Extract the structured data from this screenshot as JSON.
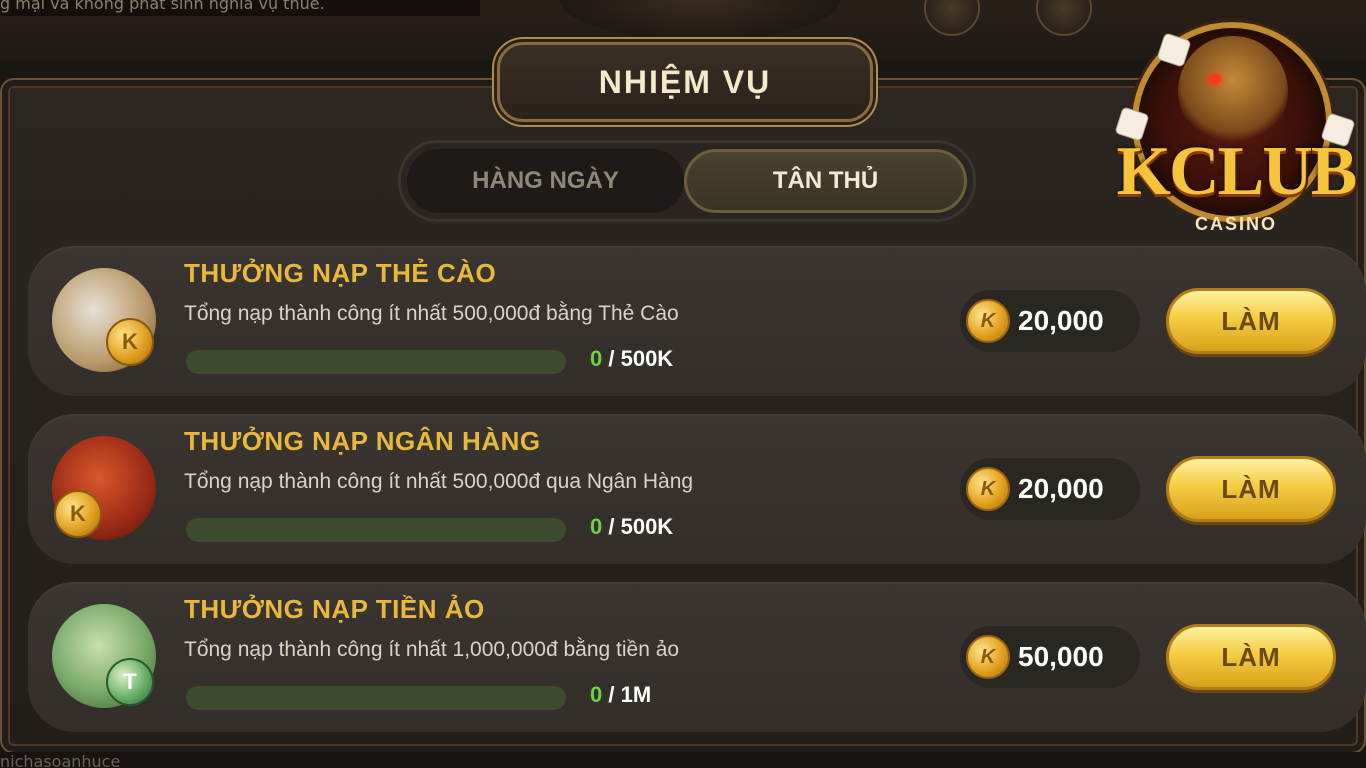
{
  "marquee": "g mại và không phát sinh nghĩa vụ thuế.",
  "bottom_text": "nichasoanhuce",
  "header": {
    "title": "NHIỆM VỤ"
  },
  "tabs": [
    {
      "label": "HÀNG NGÀY",
      "active": false
    },
    {
      "label": "TÂN THỦ",
      "active": true
    }
  ],
  "missions": [
    {
      "title": "THƯỞNG NẠP THẺ CÀO",
      "description": "Tổng nạp thành công ít nhất 500,000đ bằng Thẻ Cào",
      "progress_current": "0",
      "progress_sep": " / ",
      "progress_target": "500K",
      "progress_fraction": 0,
      "reward": "20,000",
      "button": "LÀM",
      "icon": "scratch-card-icon"
    },
    {
      "title": "THƯỞNG NẠP NGÂN HÀNG",
      "description": "Tổng nạp thành công ít nhất 500,000đ qua Ngân Hàng",
      "progress_current": "0",
      "progress_sep": " / ",
      "progress_target": "500K",
      "progress_fraction": 0,
      "reward": "20,000",
      "button": "LÀM",
      "icon": "bank-coins-icon"
    },
    {
      "title": "THƯỞNG NẠP TIỀN ẢO",
      "description": "Tổng nạp thành công ít nhất 1,000,000đ bằng tiền ảo",
      "progress_current": "0",
      "progress_sep": " / ",
      "progress_target": "1M",
      "progress_fraction": 0,
      "reward": "50,000",
      "button": "LÀM",
      "icon": "crypto-coin-icon"
    }
  ],
  "coin_letter": "K",
  "logo": {
    "name": "KCLUB",
    "sub": "CASINO"
  },
  "colors": {
    "accent_gold": "#e8b83a",
    "button_gold": "#f4cc42",
    "progress_green": "#6fd04a",
    "panel_bg": "#2c2620"
  }
}
